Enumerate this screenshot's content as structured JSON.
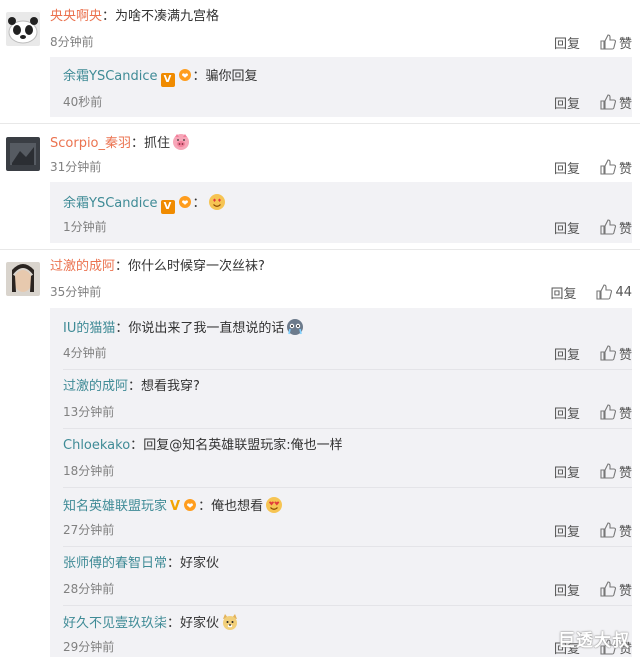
{
  "labels": {
    "reply": "回复",
    "like": "赞"
  },
  "comments": [
    {
      "user": "央央啊央",
      "text": "为啥不凑满九宫格",
      "time": "8分钟前",
      "likes": "赞",
      "replies": [
        {
          "user": "余霜YSCandice",
          "text": "骗你回复",
          "time": "40秒前",
          "likes": "赞"
        }
      ]
    },
    {
      "user": "Scorpio_秦羽",
      "text": "抓住",
      "time": "31分钟前",
      "likes": "赞",
      "replies": [
        {
          "user": "余霜YSCandice",
          "text": "",
          "time": "1分钟前",
          "likes": "赞"
        }
      ]
    },
    {
      "user": "过激的成阿",
      "text": "你什么时候穿一次丝袜?",
      "time": "35分钟前",
      "likes": "44",
      "replies": [
        {
          "user": "IU的猫猫",
          "text": "你说出来了我一直想说的话",
          "time": "4分钟前",
          "likes": "赞"
        },
        {
          "user": "过激的成阿",
          "text": "想看我穿?",
          "time": "13分钟前",
          "likes": "赞"
        },
        {
          "user": "Chloekako",
          "text": "回复@知名英雄联盟玩家:俺也一样",
          "time": "18分钟前",
          "likes": "赞"
        },
        {
          "user": "知名英雄联盟玩家",
          "text": "俺也想看",
          "time": "27分钟前",
          "likes": "赞"
        },
        {
          "user": "张师傅的春智日常",
          "text": "好家伙",
          "time": "28分钟前",
          "likes": "赞"
        },
        {
          "user": "好久不见壹玖玖柒",
          "text": "好家伙",
          "time": "29分钟前",
          "likes": "赞"
        }
      ]
    }
  ],
  "watermark": "巨透大叔",
  "colors": {
    "username": "#eb7350",
    "reply_bg": "#f2f2f5",
    "time": "#808080"
  }
}
